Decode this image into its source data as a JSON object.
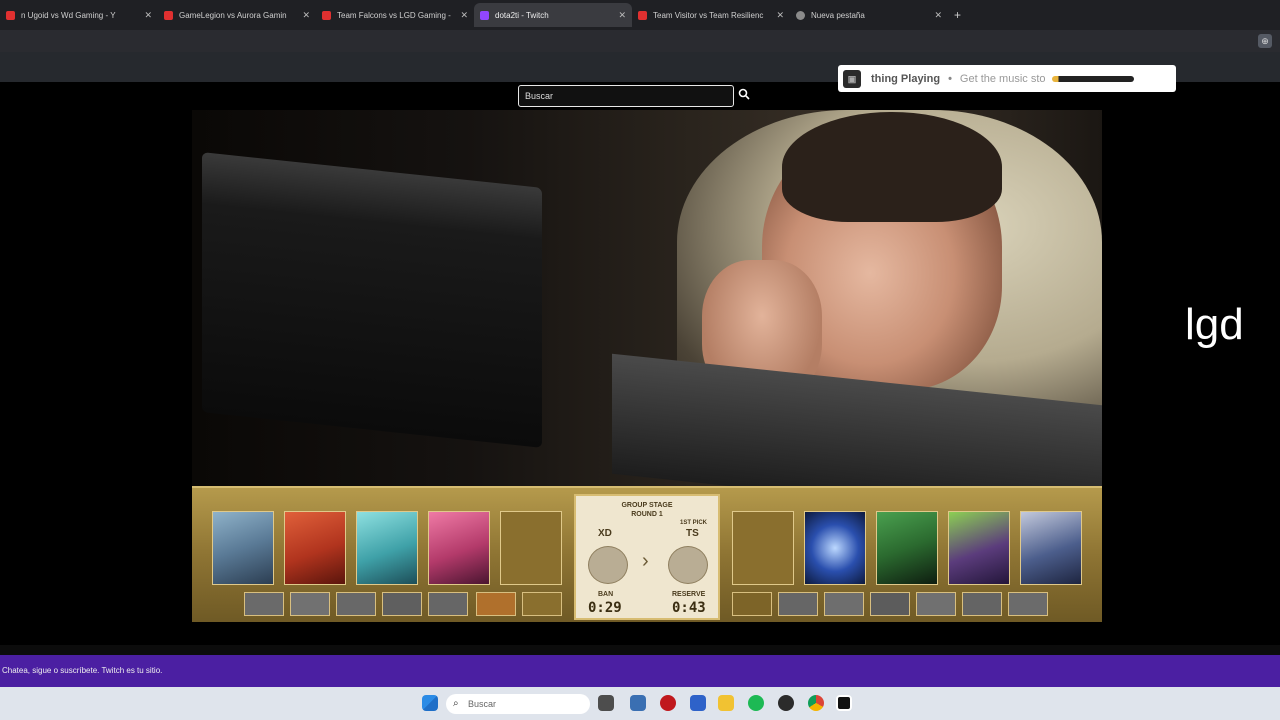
{
  "browser": {
    "tabs": [
      {
        "title": "n Ugoid vs Wd Gaming - Y",
        "fav_color": "#e03030",
        "active": false
      },
      {
        "title": "GameLegion vs Aurora Gamin",
        "fav_color": "#e03030",
        "active": false
      },
      {
        "title": "Team Falcons vs LGD Gaming -",
        "fav_color": "#e03030",
        "active": false
      },
      {
        "title": "dota2ti - Twitch",
        "fav_color": "#9146ff",
        "active": true
      },
      {
        "title": "Team Visitor vs Team Resilienc",
        "fav_color": "#e03030",
        "active": false
      },
      {
        "title": "Nueva pestaña",
        "fav_color": "#8a8a8a",
        "active": false
      }
    ],
    "close_glyph": "✕",
    "new_tab_glyph": "+"
  },
  "search": {
    "placeholder": "Buscar",
    "icon": "search-icon"
  },
  "music_widget": {
    "status": "thing Playing",
    "separator": "•",
    "cta": "Get the music sto"
  },
  "overlay_text": "lgd",
  "draft": {
    "stage_title": "GROUP STAGE",
    "stage_sub": "ROUND 1",
    "left_team": "XD",
    "right_team": "TS",
    "left_label": "BAN",
    "right_label": "RESERVE",
    "right_note": "1ST PICK",
    "left_time": "0:29",
    "right_time": "0:43",
    "arrow": "›",
    "left_heroes": [
      {
        "color": "#5a7a96"
      },
      {
        "color": "#b1341e"
      },
      {
        "color": "#3fa1a8"
      },
      {
        "color": "#b33a6a"
      },
      {
        "color": "empty"
      }
    ],
    "right_heroes": [
      {
        "color": "empty"
      },
      {
        "color": "#2a4fae"
      },
      {
        "color": "#2b6a2f"
      },
      {
        "color": "#5b3c7c"
      },
      {
        "color": "#4c5e8c"
      }
    ]
  },
  "chat_bar": {
    "text": "Chatea, sigue o suscríbete. Twitch es tu sitio."
  },
  "taskbar": {
    "search_placeholder": "Buscar"
  }
}
